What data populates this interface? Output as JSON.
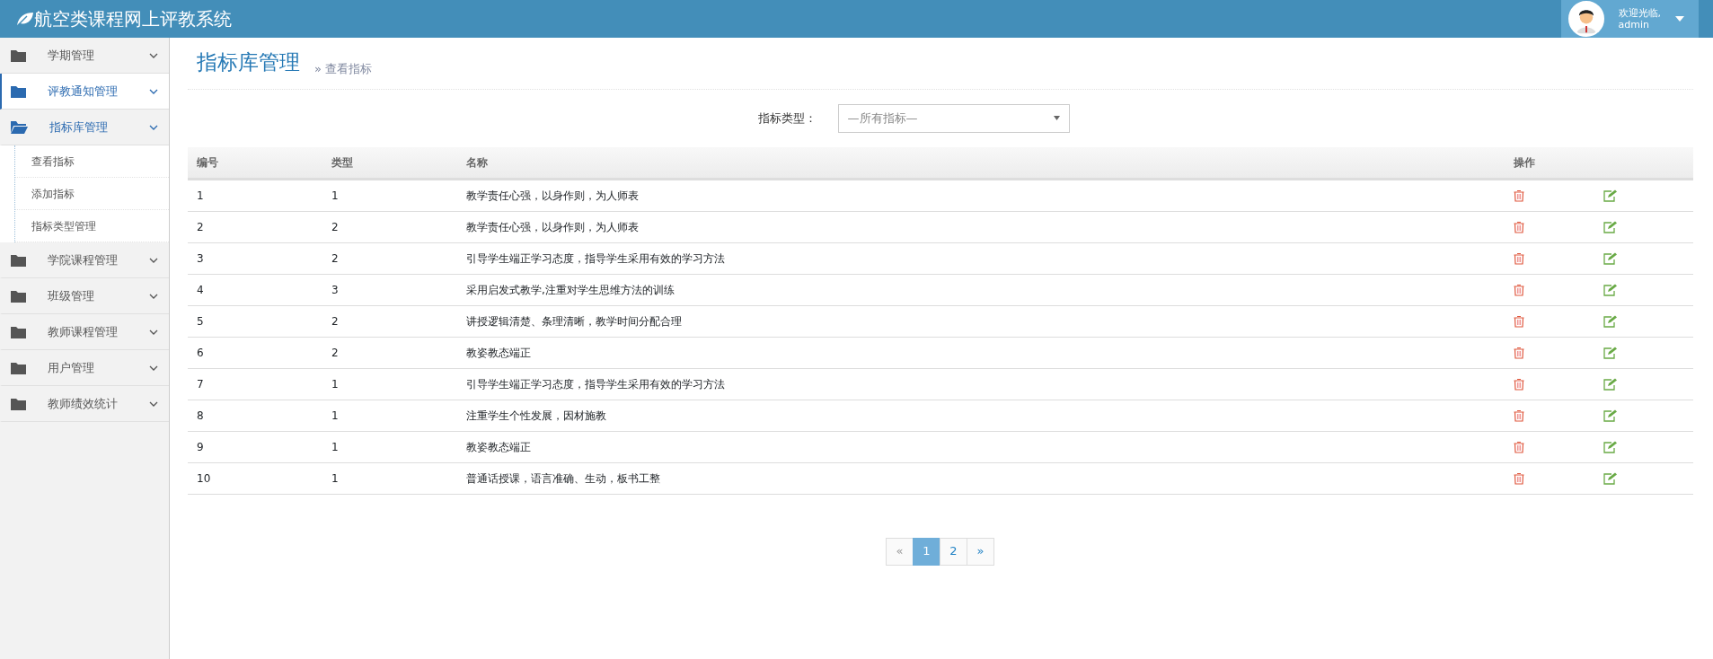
{
  "header": {
    "title": "航空类课程网上评教系统",
    "user": {
      "greeting": "欢迎光临,",
      "name": "admin"
    }
  },
  "sidebar": {
    "items": [
      {
        "label": "学期管理",
        "selected": false,
        "expanded": false
      },
      {
        "label": "评教通知管理",
        "selected": true,
        "expanded": false
      },
      {
        "label": "指标库管理",
        "selected": false,
        "expanded": true,
        "children": [
          {
            "label": "查看指标"
          },
          {
            "label": "添加指标"
          },
          {
            "label": "指标类型管理"
          }
        ]
      },
      {
        "label": "学院课程管理",
        "selected": false,
        "expanded": false
      },
      {
        "label": "班级管理",
        "selected": false,
        "expanded": false
      },
      {
        "label": "教师课程管理",
        "selected": false,
        "expanded": false
      },
      {
        "label": "用户管理",
        "selected": false,
        "expanded": false
      },
      {
        "label": "教师绩效统计",
        "selected": false,
        "expanded": false
      }
    ]
  },
  "page": {
    "title": "指标库管理",
    "breadcrumb": "» 查看指标"
  },
  "filter": {
    "label": "指标类型：",
    "value": "—所有指标—"
  },
  "table": {
    "columns": [
      "编号",
      "类型",
      "名称",
      "操作"
    ],
    "rows": [
      [
        "1",
        "1",
        "教学责任心强，以身作则，为人师表"
      ],
      [
        "2",
        "2",
        "教学责任心强，以身作则，为人师表"
      ],
      [
        "3",
        "2",
        "引导学生端正学习态度，指导学生采用有效的学习方法"
      ],
      [
        "4",
        "3",
        "采用启发式教学,注重对学生思维方法的训练"
      ],
      [
        "5",
        "2",
        "讲授逻辑清楚、条理清晰，教学时间分配合理"
      ],
      [
        "6",
        "2",
        "教姿教态端正"
      ],
      [
        "7",
        "1",
        "引导学生端正学习态度，指导学生采用有效的学习方法"
      ],
      [
        "8",
        "1",
        "注重学生个性发展，因材施教"
      ],
      [
        "9",
        "1",
        "教姿教态端正"
      ],
      [
        "10",
        "1",
        "普通话授课，语言准确、生动，板书工整"
      ]
    ]
  },
  "pagination": [
    {
      "label": "«",
      "selected": false,
      "disabled": true
    },
    {
      "label": "1",
      "selected": true,
      "disabled": false
    },
    {
      "label": "2",
      "selected": false,
      "disabled": false
    },
    {
      "label": "»",
      "selected": false,
      "disabled": false
    }
  ]
}
